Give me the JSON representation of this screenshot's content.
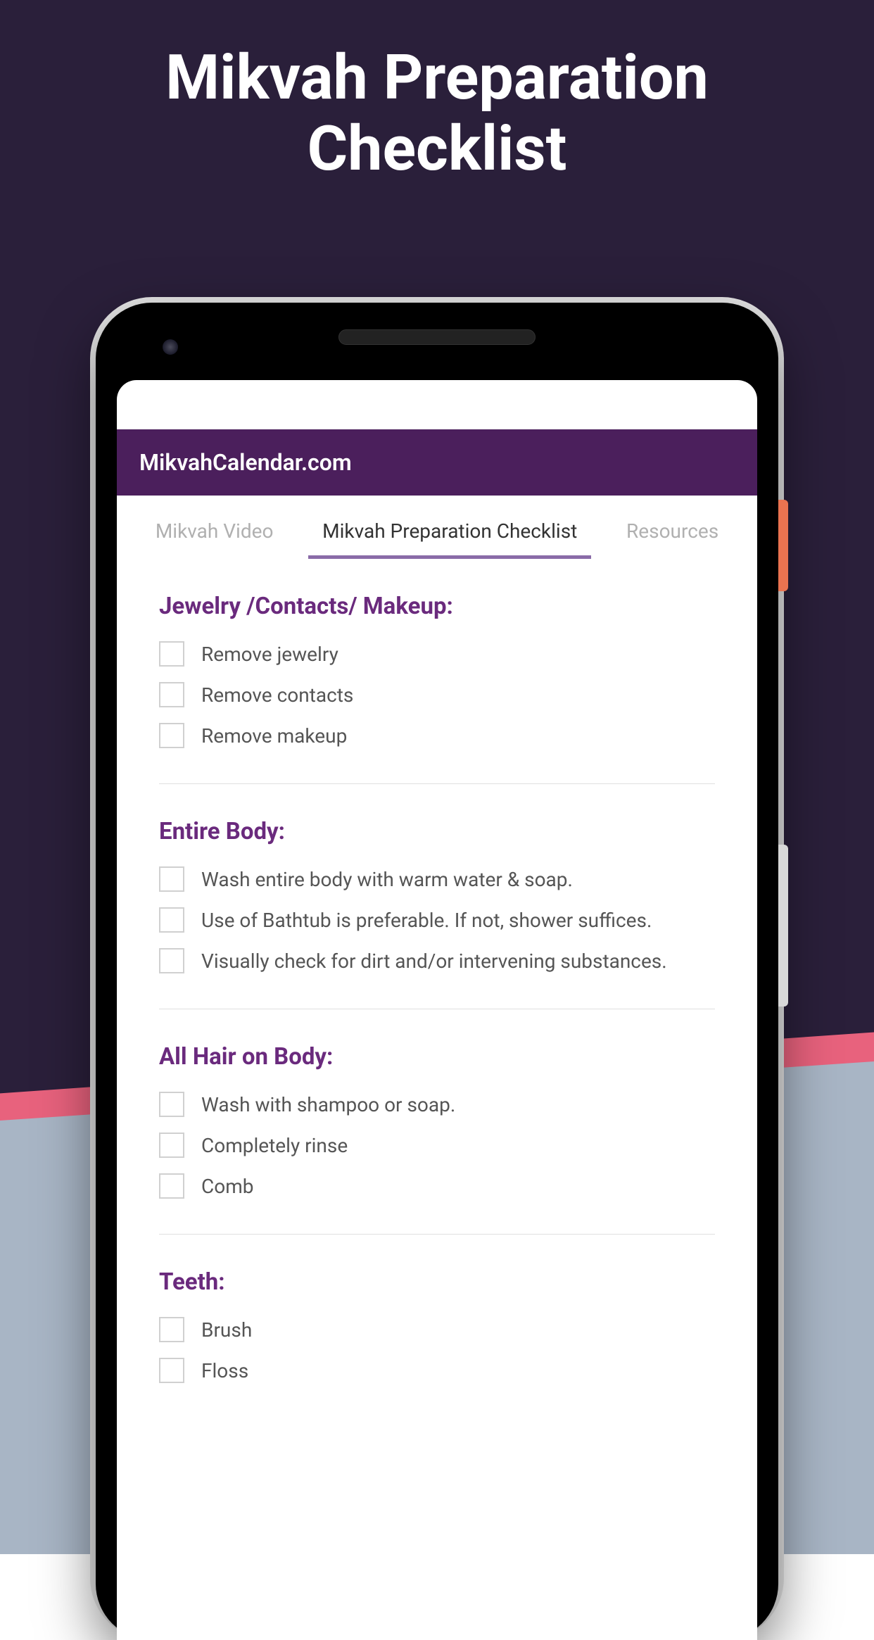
{
  "page": {
    "title": "Mikvah Preparation\nChecklist"
  },
  "app": {
    "header": "MikvahCalendar.com",
    "tabs": [
      {
        "label": "Mikvah Video",
        "active": false
      },
      {
        "label": "Mikvah Preparation Checklist",
        "active": true
      },
      {
        "label": "Resources",
        "active": false
      }
    ],
    "sections": [
      {
        "title": "Jewelry /Contacts/ Makeup:",
        "items": [
          "Remove jewelry",
          "Remove contacts",
          "Remove makeup"
        ]
      },
      {
        "title": "Entire Body:",
        "items": [
          "Wash entire body with warm water & soap.",
          "Use of Bathtub is preferable. If not, shower suffices.",
          "Visually check for dirt and/or intervening substances."
        ]
      },
      {
        "title": "All Hair on Body:",
        "items": [
          "Wash with shampoo or soap.",
          "Completely rinse",
          "Comb"
        ]
      },
      {
        "title": "Teeth:",
        "items": [
          "Brush",
          "Floss"
        ]
      }
    ]
  }
}
